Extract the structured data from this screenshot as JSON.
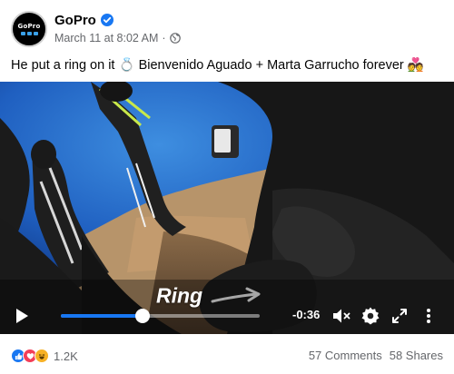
{
  "post": {
    "page_name": "GoPro",
    "timestamp": "March 11 at 8:02 AM",
    "meta_separator": "·",
    "text": "He put a ring on it 💍 Bienvenido Aguado + Marta Garrucho forever 💑",
    "avatar_text": "GoPro"
  },
  "video": {
    "overlay_text": "Ring",
    "time_remaining": "-0:36",
    "progress_fraction": 0.41
  },
  "footer": {
    "reaction_count": "1.2K",
    "comments": "57 Comments",
    "shares": "58 Shares"
  },
  "icons": {
    "verified": "verified-badge-icon",
    "audience": "globe-icon",
    "play": "play-icon",
    "mute": "volume-muted-icon",
    "settings": "gear-icon",
    "fullscreen": "expand-icon",
    "more": "more-vertical-icon",
    "reactions": [
      "like-icon",
      "love-icon",
      "haha-icon"
    ]
  },
  "colors": {
    "accent": "#1877f2",
    "text": "#050505",
    "secondary_text": "#65676b"
  }
}
